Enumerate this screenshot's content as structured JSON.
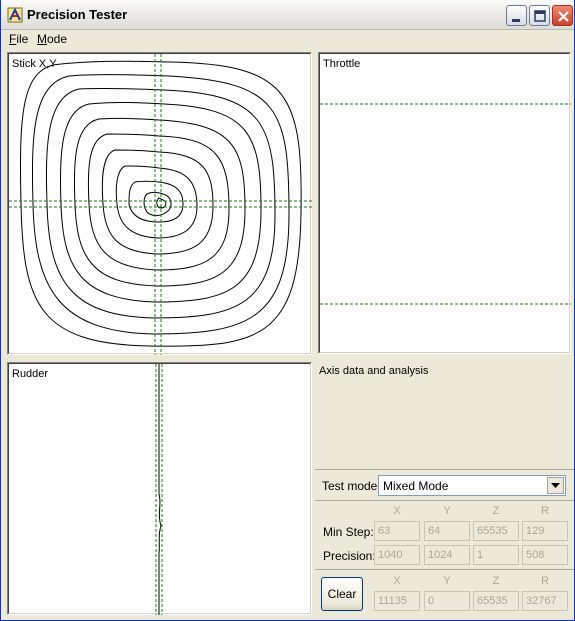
{
  "window": {
    "title": "Precision Tester"
  },
  "menu": {
    "file_acc": "F",
    "file_rest": "ile",
    "mode_acc": "M",
    "mode_rest": "ode"
  },
  "panels": {
    "stick_label": "Stick X,Y",
    "throttle_label": "Throttle",
    "rudder_label": "Rudder",
    "analysis_label": "Axis data and analysis"
  },
  "test_mode": {
    "label": "Test mode:",
    "value": "Mixed Mode"
  },
  "columns": [
    "X",
    "Y",
    "Z",
    "R"
  ],
  "min_step": {
    "label": "Min Step:",
    "values": [
      "63",
      "64",
      "65535",
      "129"
    ]
  },
  "precision": {
    "label": "Precision:",
    "values": [
      "1040",
      "1024",
      "1",
      "508"
    ]
  },
  "current": {
    "values": [
      "11135",
      "0",
      "65535",
      "32767"
    ]
  },
  "clear_label": "Clear",
  "colors": {
    "guide": "#1a7a1a",
    "trace": "#000000",
    "titlebar": "#eeede8"
  }
}
